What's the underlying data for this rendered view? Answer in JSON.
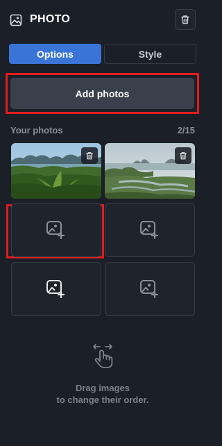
{
  "header": {
    "title": "PHOTO",
    "icon": "image-icon",
    "delete_icon": "trash-icon"
  },
  "tabs": [
    {
      "label": "Options",
      "active": true
    },
    {
      "label": "Style",
      "active": false
    }
  ],
  "add_button": {
    "label": "Add photos"
  },
  "photos": {
    "label": "Your photos",
    "count": "2/15",
    "items": [
      {
        "type": "photo",
        "subject": "tropical bay with palms and karst islands"
      },
      {
        "type": "photo",
        "subject": "coastal wetland with islands at dusk"
      },
      {
        "type": "empty",
        "icon": "add-image-icon"
      },
      {
        "type": "empty",
        "icon": "add-image-icon"
      },
      {
        "type": "empty",
        "icon": "add-image-icon"
      },
      {
        "type": "empty",
        "icon": "add-image-icon"
      }
    ]
  },
  "hint": {
    "line1": "Drag images",
    "line2": "to change their order."
  },
  "colors": {
    "background": "#1b1f28",
    "accent": "#3a74d6",
    "highlight": "#e31c1c",
    "muted_text": "#8a8e97"
  }
}
